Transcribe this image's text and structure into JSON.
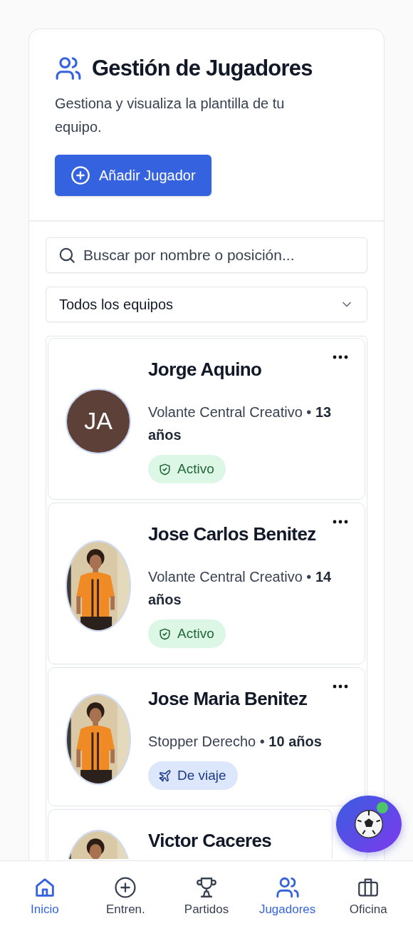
{
  "header": {
    "title": "Gestión de Jugadores",
    "subtitle": "Gestiona y visualiza la plantilla de tu equipo.",
    "add_button": "Añadir Jugador"
  },
  "search": {
    "placeholder": "Buscar por nombre o posición..."
  },
  "team_filter": {
    "value": "Todos los equipos"
  },
  "players": [
    {
      "name": "Jorge Aquino",
      "meta": "Volante Central Creativo • **13 años**",
      "avatar": {
        "kind": "initials",
        "initials": "JA",
        "color": "#5d4037"
      },
      "status": {
        "kind": "active",
        "label": "Activo"
      }
    },
    {
      "name": "Jose Carlos Benitez",
      "meta": "Volante Central Creativo • **14 años**",
      "status": {
        "kind": "active",
        "label": "Activo"
      }
    },
    {
      "name": "Jose Maria Benitez",
      "meta": "Stopper Derecho • **10 años**",
      "status": {
        "kind": "travel",
        "label": "De viaje"
      }
    },
    {
      "name": "Victor Caceres"
    }
  ],
  "fab": {
    "notification": true
  },
  "nav": [
    {
      "label": "Inicio",
      "kind": "home",
      "selected": true
    },
    {
      "label": "Entren.",
      "kind": "plus",
      "selected": false
    },
    {
      "label": "Partidos",
      "kind": "trophy",
      "selected": false
    },
    {
      "label": "Jugadores",
      "kind": "users",
      "selected": true
    },
    {
      "label": "Oficina",
      "kind": "briefcase",
      "selected": false
    }
  ]
}
